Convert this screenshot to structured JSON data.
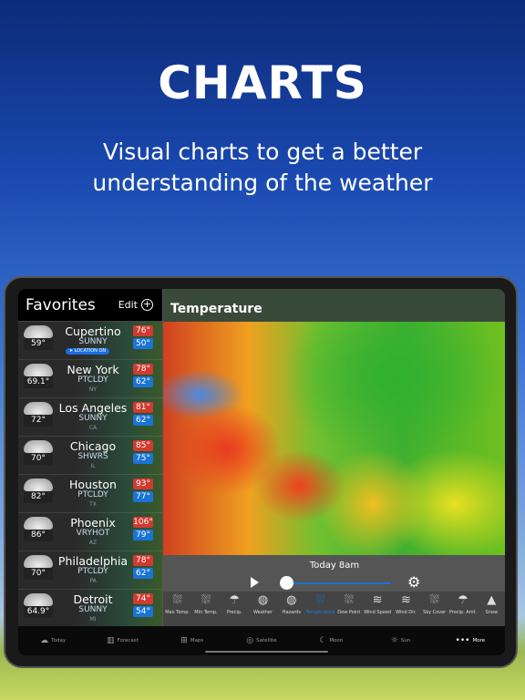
{
  "promo": {
    "headline": "CHARTS",
    "subtitle_line1": "Visual charts to get a better",
    "subtitle_line2": "understanding of the weather"
  },
  "favorites": {
    "title": "Favorites",
    "edit_label": "Edit",
    "location_badge": "LOCATION ON",
    "cities": [
      {
        "name": "Cupertino",
        "cond": "SUNNY",
        "state": "",
        "current": "59°",
        "hi": "76°",
        "lo": "50°"
      },
      {
        "name": "New York",
        "cond": "PTCLDY",
        "state": "NY",
        "current": "69.1°",
        "hi": "78°",
        "lo": "62°"
      },
      {
        "name": "Los Angeles",
        "cond": "SUNNY",
        "state": "CA",
        "current": "72°",
        "hi": "81°",
        "lo": "62°"
      },
      {
        "name": "Chicago",
        "cond": "SHWRS",
        "state": "IL",
        "current": "70°",
        "hi": "85°",
        "lo": "75°"
      },
      {
        "name": "Houston",
        "cond": "PTCLDY",
        "state": "TX",
        "current": "82°",
        "hi": "93°",
        "lo": "77°"
      },
      {
        "name": "Phoenix",
        "cond": "VRYHOT",
        "state": "AZ",
        "current": "86°",
        "hi": "106°",
        "lo": "79°"
      },
      {
        "name": "Philadelphia",
        "cond": "PTCLDY",
        "state": "PA",
        "current": "70°",
        "hi": "78°",
        "lo": "62°"
      },
      {
        "name": "Detroit",
        "cond": "SUNNY",
        "state": "MI",
        "current": "64.9°",
        "hi": "74°",
        "lo": "54°"
      }
    ]
  },
  "main": {
    "title": "Temperature",
    "time_label": "Today 8am",
    "slider_value": 0.05,
    "accent": "#1a7ae8",
    "layers": [
      {
        "label": "Max Temp.",
        "icon": "map-icon"
      },
      {
        "label": "Min Temp.",
        "icon": "map-icon"
      },
      {
        "label": "Precip.",
        "icon": "umbrella-icon"
      },
      {
        "label": "Weather",
        "icon": "globe-icon"
      },
      {
        "label": "Hazards",
        "icon": "globe-icon"
      },
      {
        "label": "Temperature",
        "icon": "map-icon",
        "active": true
      },
      {
        "label": "Dew Point",
        "icon": "map-icon"
      },
      {
        "label": "Wind Speed",
        "icon": "wind-icon"
      },
      {
        "label": "Wind Dir.",
        "icon": "wind-icon"
      },
      {
        "label": "Sky Cover",
        "icon": "map-icon"
      },
      {
        "label": "Precip. Amt.",
        "icon": "umbrella-icon"
      },
      {
        "label": "Snow",
        "icon": "snow-icon"
      }
    ]
  },
  "tabs": [
    {
      "label": "Today",
      "icon": "☁"
    },
    {
      "label": "Forecast",
      "icon": "▥"
    },
    {
      "label": "Maps",
      "icon": "⊞"
    },
    {
      "label": "Satellite",
      "icon": "◎"
    },
    {
      "label": "Moon",
      "icon": "☾"
    },
    {
      "label": "Sun",
      "icon": "☼"
    },
    {
      "label": "More",
      "icon": "•••"
    }
  ]
}
